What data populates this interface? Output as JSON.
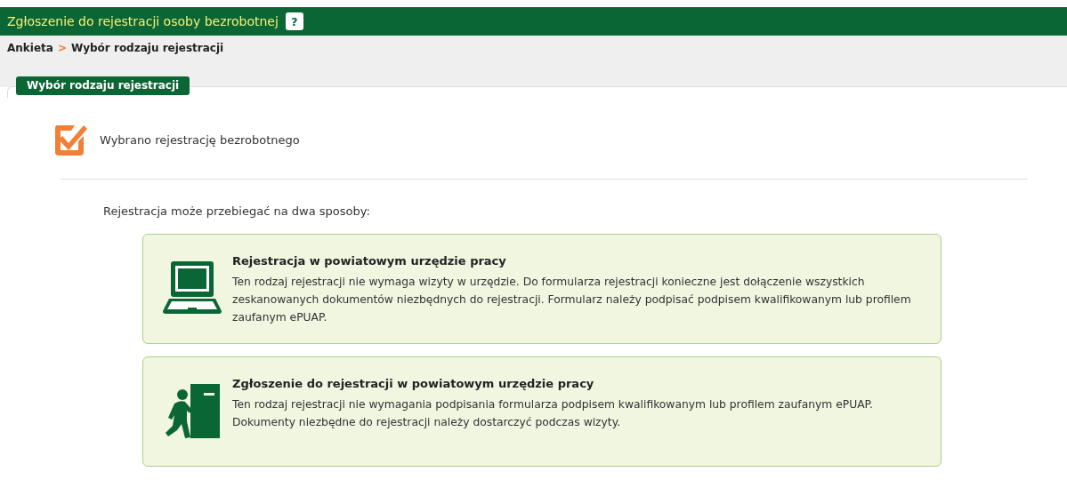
{
  "header": {
    "title": "Zgłoszenie do rejestracji osoby bezrobotnej",
    "help": "?"
  },
  "breadcrumb": [
    {
      "label": "Ankieta",
      "separator": ">"
    },
    {
      "label": "Wybór rodzaju rejestracji"
    }
  ],
  "section_tab": "Wybór rodzaju rejestracji",
  "selection": {
    "checked": true,
    "text": "Wybrano rejestrację bezrobotnego"
  },
  "intro": "Rejestracja może przebiegać na dwa sposoby:",
  "options": [
    {
      "kind": "laptop",
      "title": "Rejestracja w powiatowym urzędzie pracy",
      "description": "Ten rodzaj rejestracji nie wymaga wizyty w urzędzie. Do formularza rejestracji konieczne jest dołączenie wszystkich zeskanowanych dokumentów niezbędnych do rejestracji. Formularz należy podpisać podpisem kwalifikowanym lub profilem zaufanym ePUAP."
    },
    {
      "kind": "walk-in",
      "title": "Zgłoszenie do rejestracji w powiatowym urzędzie pracy",
      "description": "Ten rodzaj rejestracji nie wymagania podpisania formularza podpisem kwalifikowanym lub profilem zaufanym ePUAP. Dokumenty niezbędne do rejestracji należy dostarczyć podczas wizyty."
    }
  ]
}
